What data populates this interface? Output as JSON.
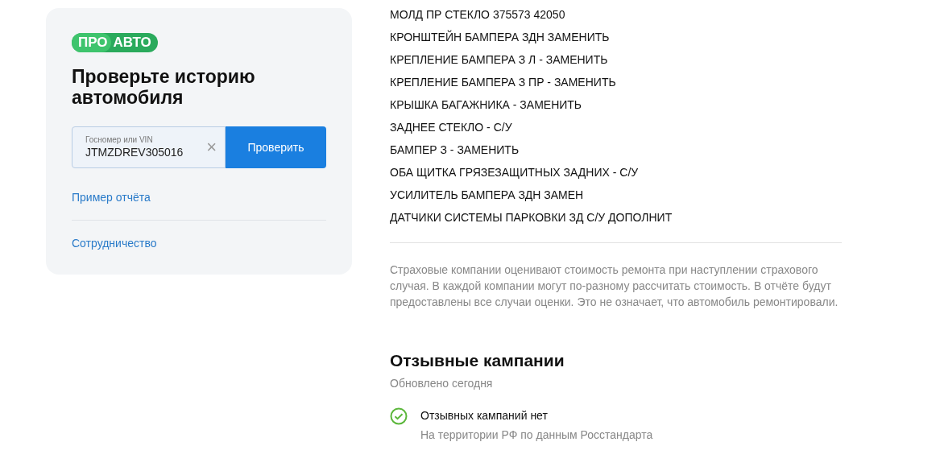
{
  "sidebar": {
    "logo": {
      "part_1": "ПРО",
      "part_2": "АВТО"
    },
    "title": "Проверьте историю автомобиля",
    "search": {
      "placeholder": "Госномер или VIN",
      "value": "JTMZDREV305016",
      "clear": "×",
      "button": "Проверить"
    },
    "links": [
      "Пример отчёта",
      "Сотрудничество"
    ]
  },
  "repairs": [
    "МОЛД ПР СТЕКЛО 375573 42050",
    "КРОНШТЕЙН БАМПЕРА ЗДН ЗАМЕНИТЬ",
    "КРЕПЛЕНИЕ БАМПЕРА З Л - ЗАМЕНИТЬ",
    "КРЕПЛЕНИЕ БАМПЕРА З ПР - ЗАМЕНИТЬ",
    "КРЫШКА БАГАЖНИКА - ЗАМЕНИТЬ",
    "ЗАДНЕЕ СТЕКЛО - С/У",
    "БАМПЕР З - ЗАМЕНИТЬ",
    "ОБА ЩИТКА ГРЯЗЕЗАЩИТНЫХ ЗАДНИХ - С/У",
    "УСИЛИТЕЛЬ БАМПЕРА ЗДН ЗАМЕН",
    "ДАТЧИКИ СИСТЕМЫ ПАРКОВКИ ЗД С/У ДОПОЛНИТ"
  ],
  "note": "Страховые компании оценивают стоимость ремонта при наступлении страхового случая. В каждой компании могут по-разному рассчитать стоимость. В отчёте будут предоставлены все случаи оценки. Это не означает, что автомобиль ремонтировали.",
  "recalls": {
    "title": "Отзывные кампании",
    "updated": "Обновлено сегодня",
    "items": [
      {
        "kind": "ok",
        "text": "Отзывных кампаний нет",
        "source": "На территории РФ по данным Росстандарта"
      }
    ]
  }
}
